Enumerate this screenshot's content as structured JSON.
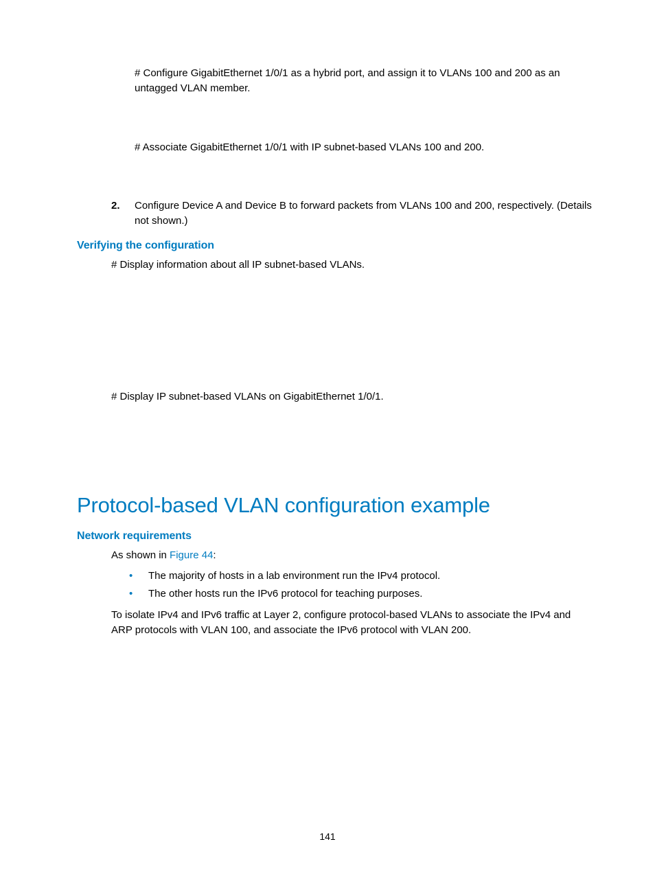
{
  "block1": {
    "p1": "# Configure GigabitEthernet 1/0/1 as a hybrid port, and assign it to VLANs 100 and 200 as an untagged VLAN member.",
    "p2": "# Associate GigabitEthernet 1/0/1 with IP subnet-based VLANs 100 and 200."
  },
  "step2": {
    "num": "2.",
    "text": "Configure Device A and Device B to forward packets from VLANs 100 and 200, respectively. (Details not shown.)"
  },
  "verify": {
    "heading": "Verifying the configuration",
    "p1": "# Display information about all IP subnet-based VLANs.",
    "p2": "# Display IP subnet-based VLANs on GigabitEthernet 1/0/1."
  },
  "section": {
    "title": "Protocol-based VLAN configuration example",
    "sub": "Network requirements",
    "intro_prefix": "As shown in ",
    "intro_link": "Figure 44",
    "intro_suffix": ":",
    "bullets": [
      "The majority of hosts in a lab environment run the IPv4 protocol.",
      "The other hosts run the IPv6 protocol for teaching purposes."
    ],
    "para": "To isolate IPv4 and IPv6 traffic at Layer 2, configure protocol-based VLANs to associate the IPv4 and ARP protocols with VLAN 100, and associate the IPv6 protocol with VLAN 200."
  },
  "page_number": "141"
}
